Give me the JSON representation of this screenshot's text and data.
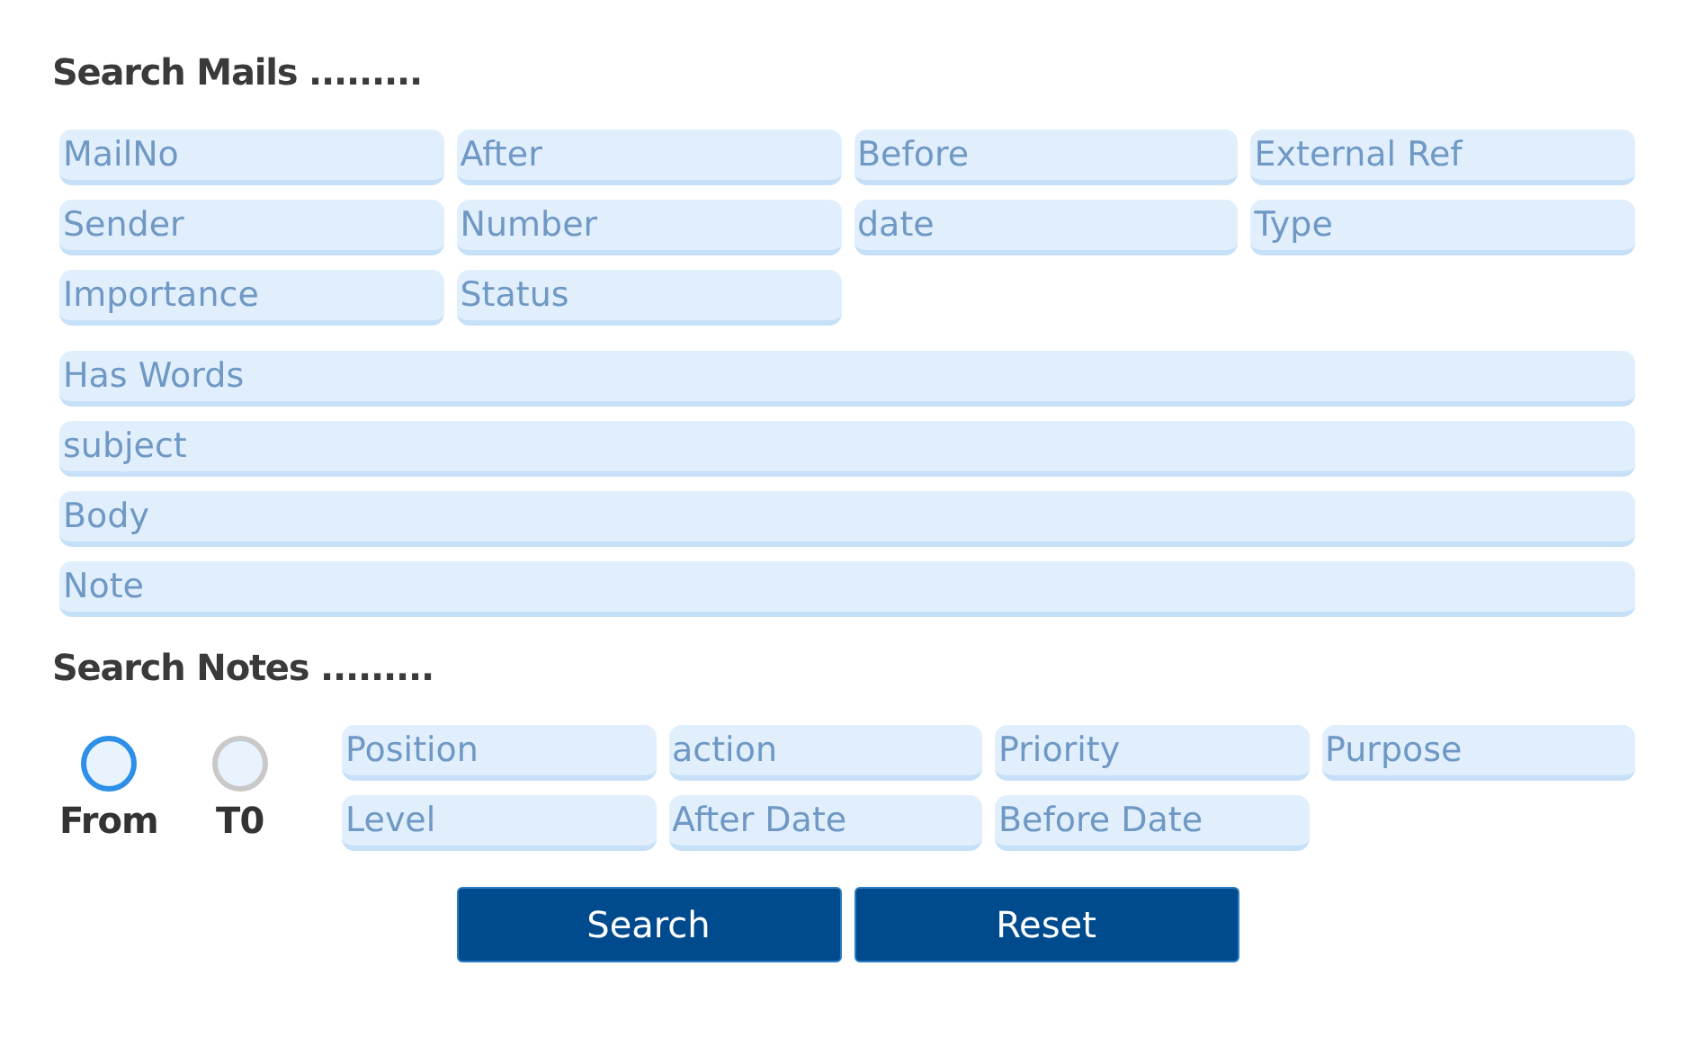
{
  "mail_search": {
    "title": "Search Mails .........",
    "fields": [
      {
        "placeholder": "MailNo"
      },
      {
        "placeholder": "After"
      },
      {
        "placeholder": "Before"
      },
      {
        "placeholder": "External Ref"
      },
      {
        "placeholder": "Sender"
      },
      {
        "placeholder": "Number"
      },
      {
        "placeholder": "date"
      },
      {
        "placeholder": "Type"
      },
      {
        "placeholder": "Importance"
      },
      {
        "placeholder": "Status"
      }
    ],
    "wide_fields": [
      {
        "placeholder": "Has Words"
      },
      {
        "placeholder": "subject"
      },
      {
        "placeholder": "Body"
      },
      {
        "placeholder": "Note"
      }
    ]
  },
  "note_search": {
    "title": "Search Notes .........",
    "direction": [
      {
        "label": "From",
        "selected": true
      },
      {
        "label": "T0",
        "selected": false
      }
    ],
    "fields": [
      {
        "placeholder": "Position"
      },
      {
        "placeholder": "action"
      },
      {
        "placeholder": "Priority"
      },
      {
        "placeholder": "Purpose"
      },
      {
        "placeholder": "Level"
      },
      {
        "placeholder": "After Date"
      },
      {
        "placeholder": "Before Date"
      }
    ]
  },
  "buttons": [
    "Search",
    "Reset"
  ]
}
